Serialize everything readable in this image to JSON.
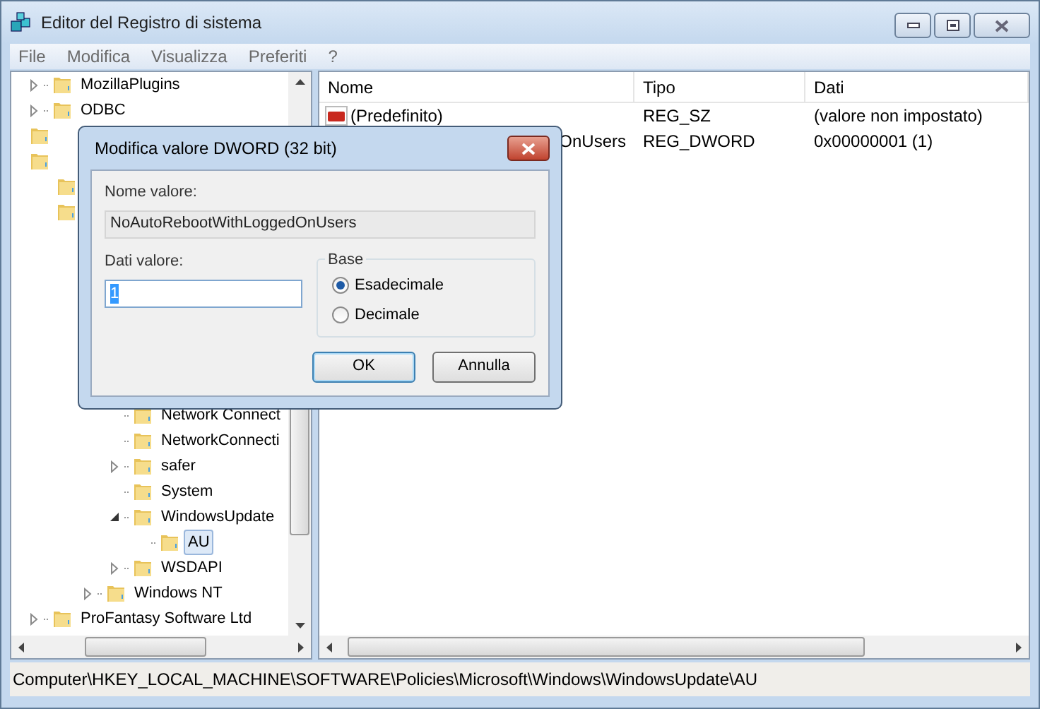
{
  "window": {
    "title": "Editor del Registro di sistema"
  },
  "menu": [
    "File",
    "Modifica",
    "Visualizza",
    "Preferiti",
    "?"
  ],
  "tree": [
    {
      "label": "MozillaPlugins",
      "expanded": false
    },
    {
      "label": "ODBC",
      "expanded": false
    },
    {
      "covered": true
    },
    {
      "covered": true,
      "children": [
        {
          "covered": true
        },
        {
          "covered": true,
          "children": [
            {
              "covered": true
            },
            {
              "covered": true
            },
            {
              "covered": true
            },
            {
              "covered": true
            },
            {
              "covered": true
            },
            {
              "covered": true
            },
            {
              "covered": true,
              "children": [
                {
                  "label": "Network Connect"
                },
                {
                  "label": "NetworkConnecti"
                },
                {
                  "label": "safer",
                  "expanded": false
                },
                {
                  "label": "System"
                },
                {
                  "label": "WindowsUpdate",
                  "expanded": true,
                  "children": [
                    {
                      "label": "AU",
                      "selected": true
                    }
                  ]
                },
                {
                  "label": "WSDAPI",
                  "expanded": false
                }
              ]
            },
            {
              "label": "Windows NT",
              "expanded": false,
              "selected": false
            }
          ]
        }
      ]
    },
    {
      "label": "ProFantasy Software Ltd",
      "expanded": false
    }
  ],
  "table": {
    "columns": [
      "Nome",
      "Tipo",
      "Dati"
    ],
    "rows": [
      {
        "kind": "string",
        "name": "(Predefinito)",
        "type": "REG_SZ",
        "data": "(valore non impostato)"
      },
      {
        "kind": "covered",
        "name": "OnUsers",
        "type": "REG_DWORD",
        "data": "0x00000001 (1)"
      }
    ]
  },
  "status_bar": "Computer\\HKEY_LOCAL_MACHINE\\SOFTWARE\\Policies\\Microsoft\\Windows\\WindowsUpdate\\AU",
  "dialog": {
    "title": "Modifica valore DWORD (32 bit)",
    "name_label": "Nome valore:",
    "name_value": "NoAutoRebootWithLoggedOnUsers",
    "data_label": "Dati valore:",
    "data_value": "1",
    "base_label": "Base",
    "radios": [
      {
        "label": "Esadecimale",
        "selected": true
      },
      {
        "label": "Decimale",
        "selected": false
      }
    ],
    "buttons": [
      "OK",
      "Annulla"
    ]
  }
}
